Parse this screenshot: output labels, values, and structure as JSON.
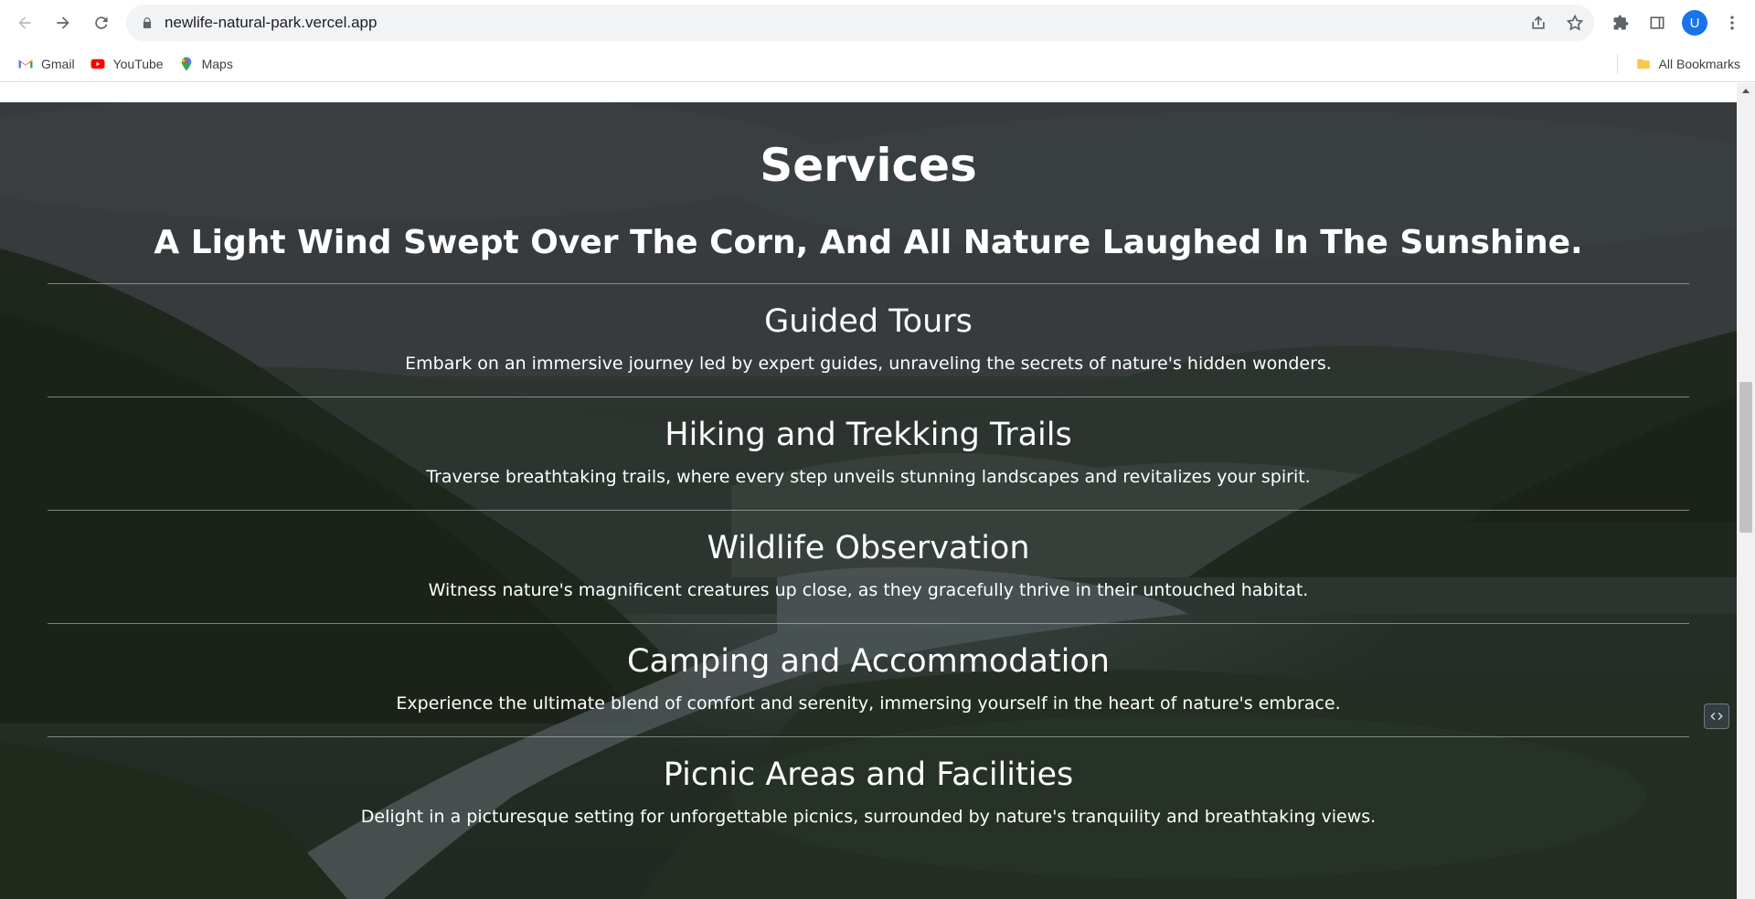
{
  "browser": {
    "url": "newlife-natural-park.vercel.app",
    "avatar_letter": "U",
    "bookmarks": [
      {
        "label": "Gmail",
        "icon": "gmail-icon"
      },
      {
        "label": "YouTube",
        "icon": "youtube-icon"
      },
      {
        "label": "Maps",
        "icon": "maps-icon"
      }
    ],
    "all_bookmarks_label": "All Bookmarks"
  },
  "page": {
    "title": "Services",
    "tagline": "A Light Wind Swept Over The Corn, And All Nature Laughed In The Sunshine.",
    "services": [
      {
        "title": "Guided Tours",
        "description": "Embark on an immersive journey led by expert guides, unraveling the secrets of nature's hidden wonders."
      },
      {
        "title": "Hiking and Trekking Trails",
        "description": "Traverse breathtaking trails, where every step unveils stunning landscapes and revitalizes your spirit."
      },
      {
        "title": "Wildlife Observation",
        "description": "Witness nature's magnificent creatures up close, as they gracefully thrive in their untouched habitat."
      },
      {
        "title": "Camping and Accommodation",
        "description": "Experience the ultimate blend of comfort and serenity, immersing yourself in the heart of nature's embrace."
      },
      {
        "title": "Picnic Areas and Facilities",
        "description": "Delight in a picturesque setting for unforgettable picnics, surrounded by nature's tranquility and breathtaking views."
      }
    ]
  },
  "colors": {
    "accent": "#1a73e8",
    "text_on_hero": "#ffffff"
  }
}
